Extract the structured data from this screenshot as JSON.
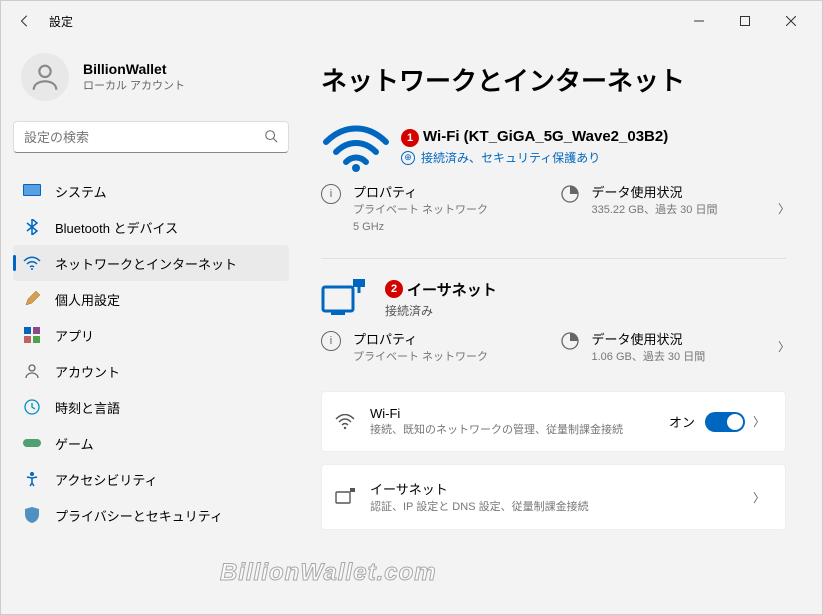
{
  "window": {
    "app_title": "設定"
  },
  "user": {
    "name": "BillionWallet",
    "sub": "ローカル アカウント"
  },
  "search": {
    "placeholder": "設定の検索"
  },
  "sidebar": {
    "items": [
      {
        "label": "システム"
      },
      {
        "label": "Bluetooth とデバイス"
      },
      {
        "label": "ネットワークとインターネット"
      },
      {
        "label": "個人用設定"
      },
      {
        "label": "アプリ"
      },
      {
        "label": "アカウント"
      },
      {
        "label": "時刻と言語"
      },
      {
        "label": "ゲーム"
      },
      {
        "label": "アクセシビリティ"
      },
      {
        "label": "プライバシーとセキュリティ"
      }
    ]
  },
  "page": {
    "title": "ネットワークとインターネット"
  },
  "wifi": {
    "badge": "1",
    "title": "Wi-Fi (KT_GiGA_5G_Wave2_03B2)",
    "status": "接続済み、セキュリティ保護あり",
    "prop": {
      "title": "プロパティ",
      "sub1": "プライベート ネットワーク",
      "sub2": "5 GHz"
    },
    "usage": {
      "title": "データ使用状況",
      "sub": "335.22 GB、過去 30 日間"
    }
  },
  "eth": {
    "badge": "2",
    "title": "イーサネット",
    "status": "接続済み",
    "prop": {
      "title": "プロパティ",
      "sub": "プライベート ネットワーク"
    },
    "usage": {
      "title": "データ使用状況",
      "sub": "1.06 GB、過去 30 日間"
    }
  },
  "cards": {
    "wifi_toggle": {
      "title": "Wi-Fi",
      "sub": "接続、既知のネットワークの管理、従量制課金接続",
      "state": "オン"
    },
    "eth_settings": {
      "title": "イーサネット",
      "sub": "認証、IP 設定と DNS 設定、従量制課金接続"
    }
  },
  "watermark": "BillionWallet.com"
}
